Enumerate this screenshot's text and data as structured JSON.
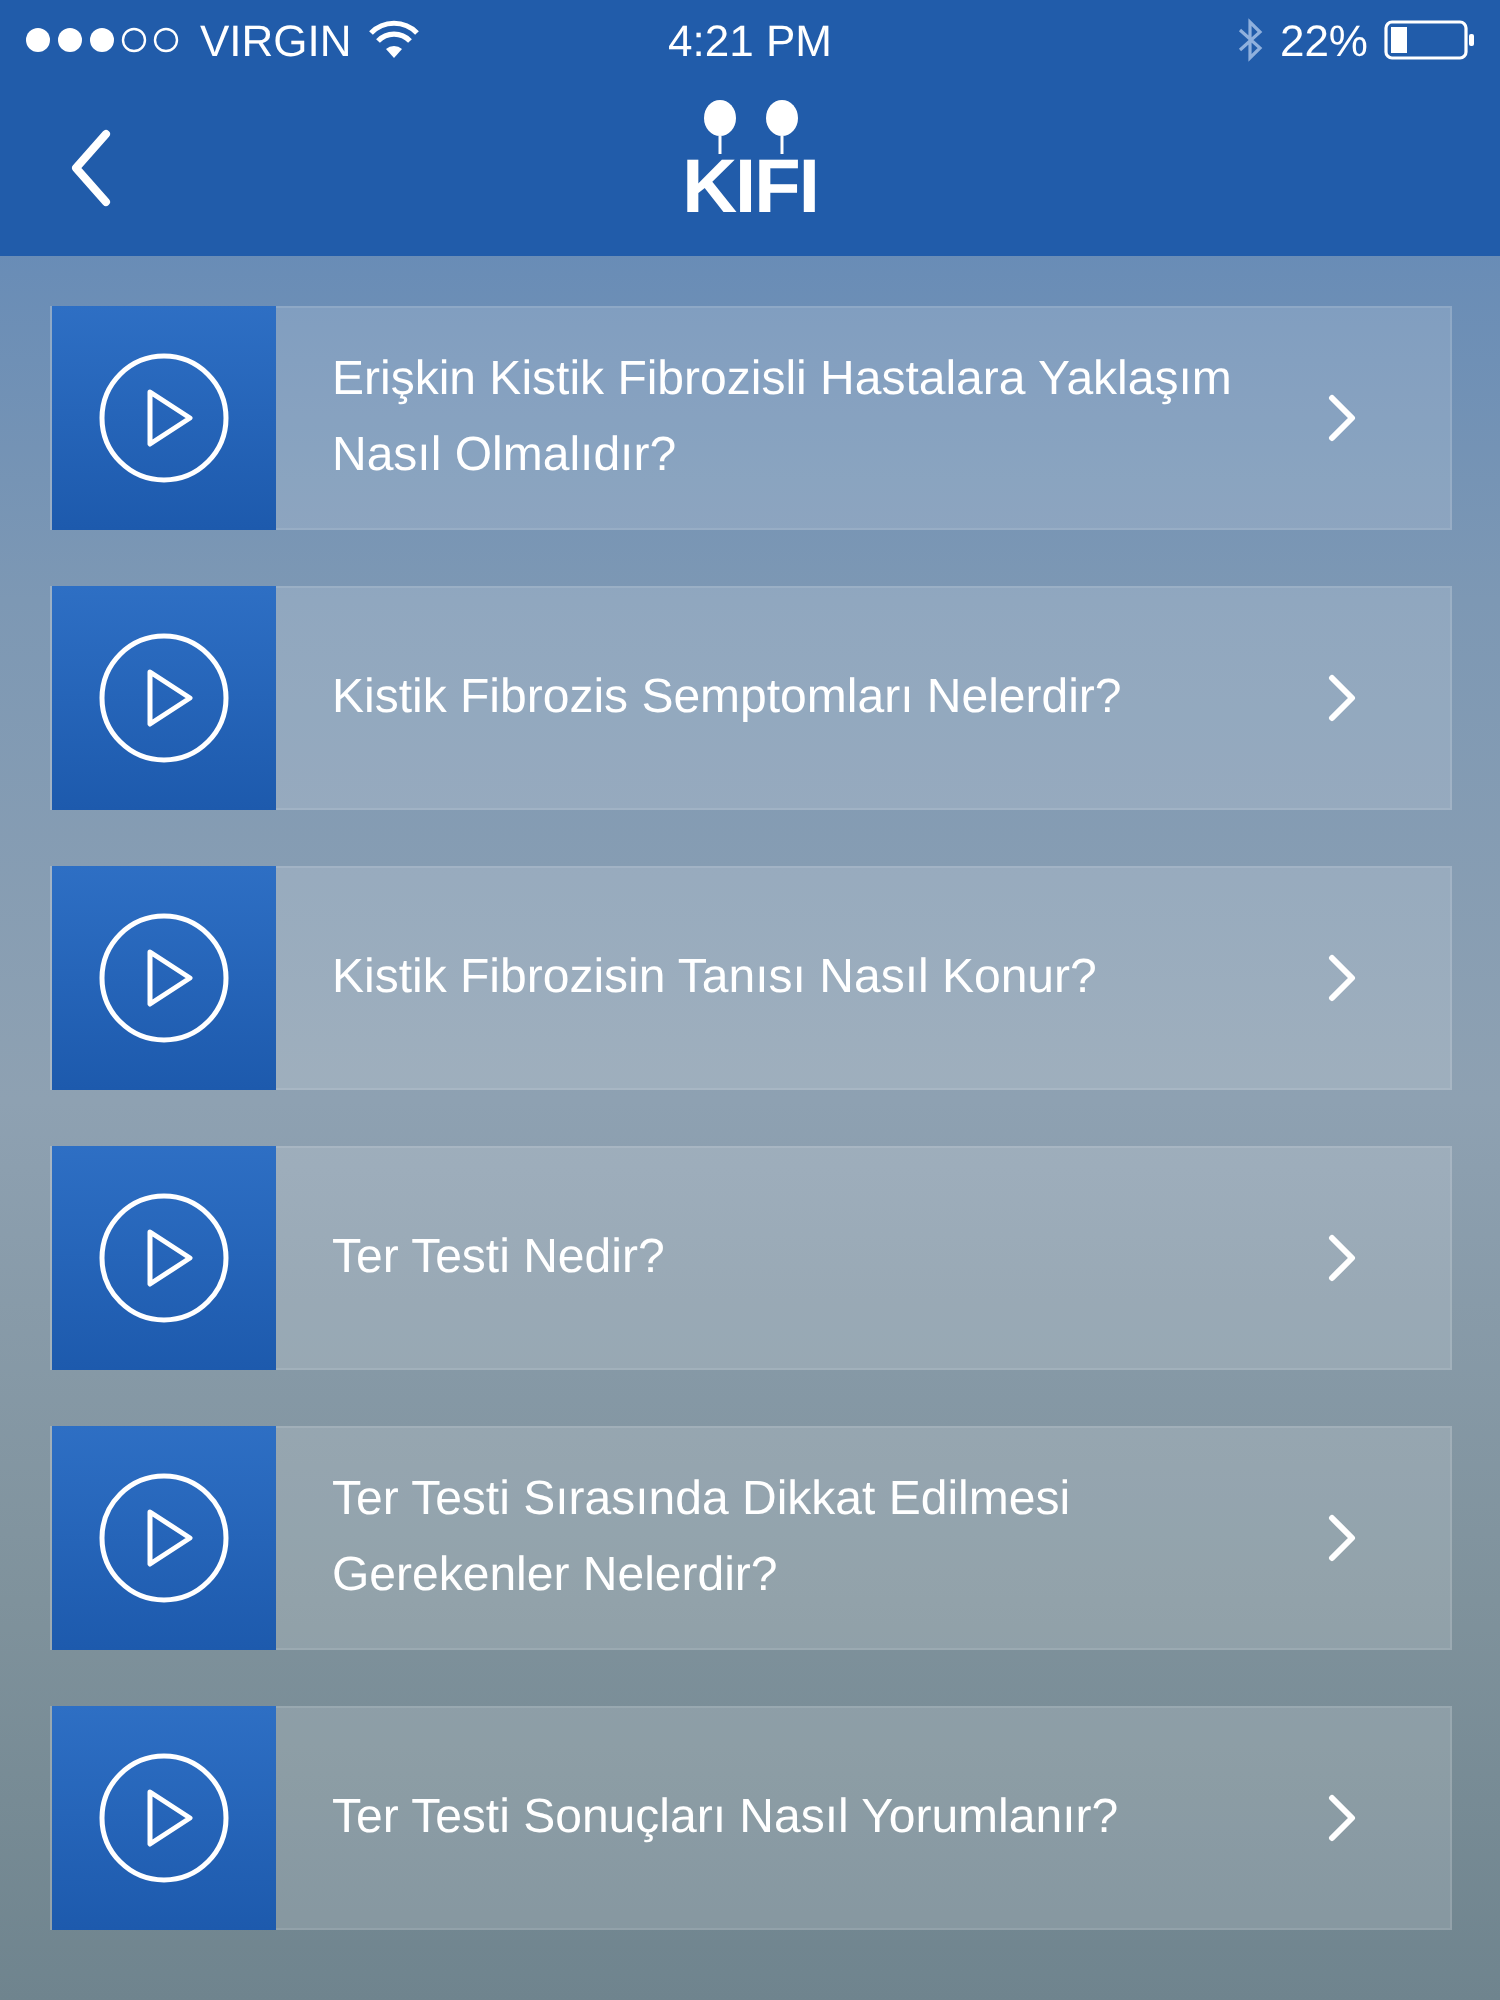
{
  "status_bar": {
    "carrier": "VIRGIN",
    "time": "4:21 PM",
    "battery": "22%"
  },
  "nav_bar": {
    "logo": "KIFI"
  },
  "videos": [
    {
      "title": "Erişkin Kistik Fibrozisli Hastalara Yaklaşım Nasıl Olmalıdır?"
    },
    {
      "title": "Kistik Fibrozis Semptomları Nelerdir?"
    },
    {
      "title": "Kistik Fibrozisin Tanısı Nasıl Konur?"
    },
    {
      "title": "Ter Testi Nedir?"
    },
    {
      "title": "Ter Testi Sırasında Dikkat Edilmesi Gerekenler Nelerdir?"
    },
    {
      "title": "Ter Testi Sonuçları Nasıl Yorumlanır?"
    }
  ]
}
